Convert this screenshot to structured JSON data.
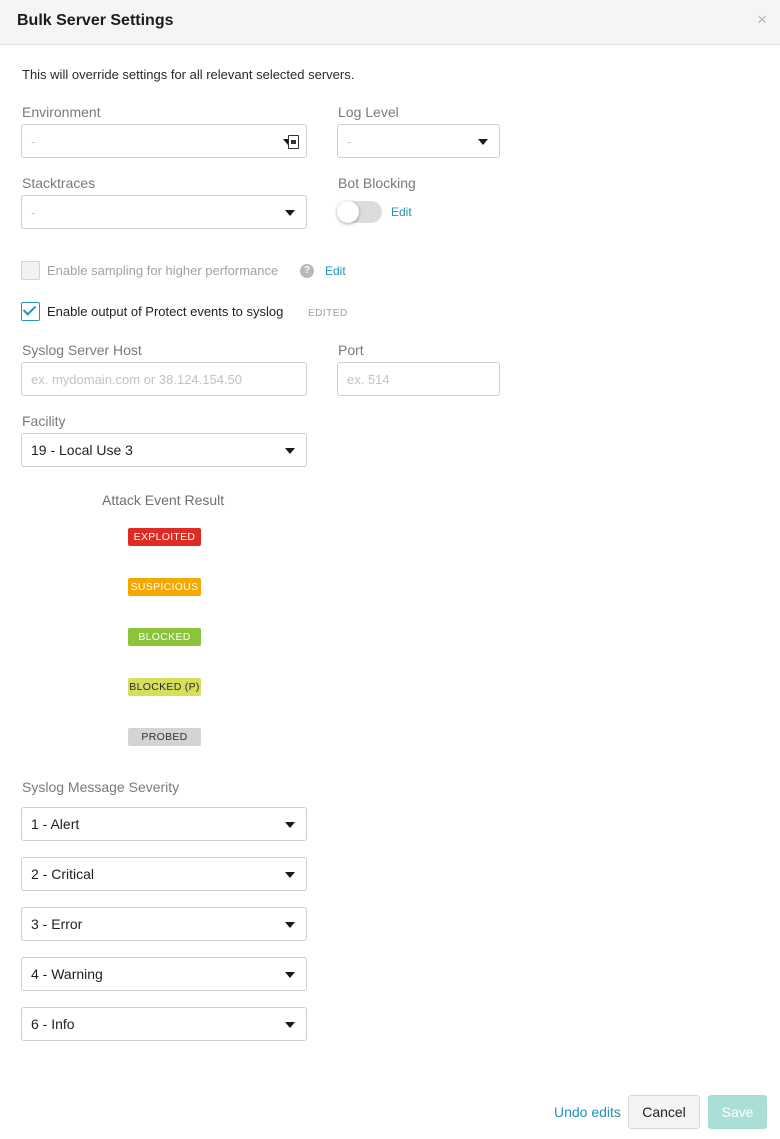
{
  "header": {
    "title": "Bulk Server Settings",
    "close_glyph": "×"
  },
  "intro": "This will override settings for all relevant selected servers.",
  "environment": {
    "label": "Environment",
    "placeholder": "-"
  },
  "log_level": {
    "label": "Log Level",
    "placeholder": "-"
  },
  "stacktraces": {
    "label": "Stacktraces",
    "placeholder": "-"
  },
  "bot_blocking": {
    "label": "Bot Blocking",
    "enabled": false,
    "edit_label": "Edit"
  },
  "sampling": {
    "label": "Enable sampling for higher performance",
    "checked": false,
    "help_glyph": "?",
    "edit_label": "Edit"
  },
  "protect_syslog": {
    "label": "Enable output of Protect events to syslog",
    "checked": true,
    "tag": "EDITED"
  },
  "syslog_host": {
    "label": "Syslog Server Host",
    "placeholder": "ex. mydomain.com or 38.124.154.50",
    "value": ""
  },
  "port": {
    "label": "Port",
    "placeholder": "ex. 514",
    "value": ""
  },
  "facility": {
    "label": "Facility",
    "value": "19 - Local Use 3"
  },
  "attack_event": {
    "heading": "Attack Event Result",
    "results": [
      {
        "label": "EXPLOITED",
        "bg": "#e02b22",
        "fg": "#ffffff"
      },
      {
        "label": "SUSPICIOUS",
        "bg": "#f7a800",
        "fg": "#ffffff"
      },
      {
        "label": "BLOCKED",
        "bg": "#8bc33b",
        "fg": "#ffffff"
      },
      {
        "label": "BLOCKED (P)",
        "bg": "#d5df5c",
        "fg": "#2b2b2b"
      },
      {
        "label": "PROBED",
        "bg": "#d4d4d4",
        "fg": "#333333"
      }
    ]
  },
  "severity": {
    "label": "Syslog Message Severity",
    "values": [
      "1 - Alert",
      "2 - Critical",
      "3 - Error",
      "4 - Warning",
      "6 - Info"
    ]
  },
  "footer": {
    "undo_label": "Undo edits",
    "cancel_label": "Cancel",
    "save_label": "Save"
  },
  "colors": {
    "accent": "#1f93b8",
    "save_disabled": "#a9dfd6",
    "header_bg": "#f5f5f5"
  }
}
